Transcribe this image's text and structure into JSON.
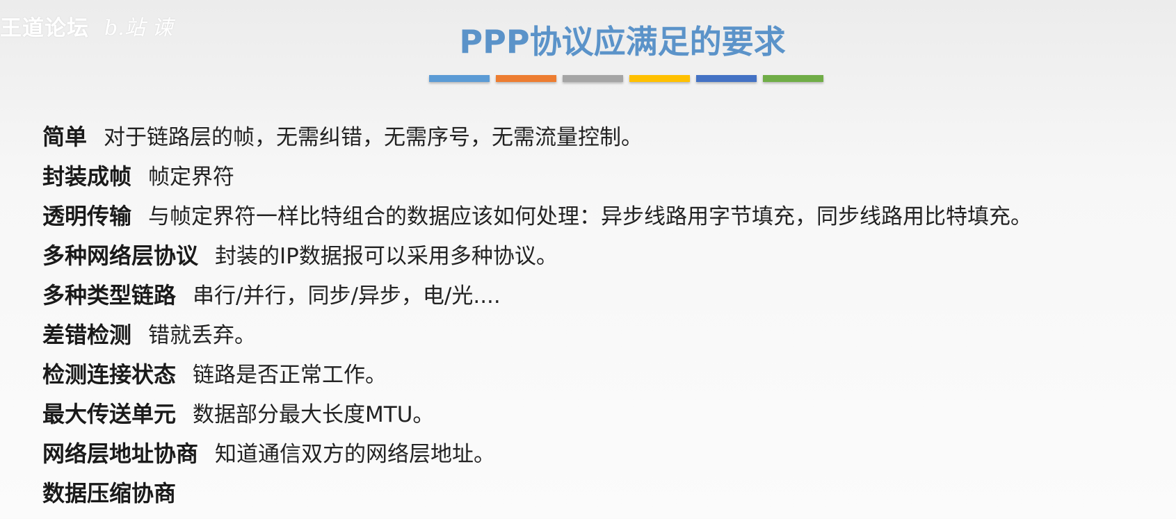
{
  "watermark": {
    "text": "王道论坛",
    "scribble": "b.站 谏"
  },
  "title": "PPP协议应满足的要求",
  "color_bar": [
    "#5b9bd5",
    "#ed7d31",
    "#a5a5a5",
    "#ffc000",
    "#4472c4",
    "#70ad47"
  ],
  "items": [
    {
      "term": "简单",
      "desc": "对于链路层的帧，无需纠错，无需序号，无需流量控制。"
    },
    {
      "term": "封装成帧",
      "desc": "帧定界符"
    },
    {
      "term": "透明传输",
      "desc": "与帧定界符一样比特组合的数据应该如何处理：异步线路用字节填充，同步线路用比特填充。"
    },
    {
      "term": "多种网络层协议",
      "desc": "封装的IP数据报可以采用多种协议。"
    },
    {
      "term": "多种类型链路",
      "desc": "串行/并行，同步/异步，电/光...."
    },
    {
      "term": "差错检测",
      "desc": "错就丢弃。"
    },
    {
      "term": "检测连接状态",
      "desc": "链路是否正常工作。"
    },
    {
      "term": "最大传送单元",
      "desc": "数据部分最大长度MTU。"
    },
    {
      "term": "网络层地址协商",
      "desc": "知道通信双方的网络层地址。"
    },
    {
      "term": "数据压缩协商",
      "desc": ""
    }
  ]
}
